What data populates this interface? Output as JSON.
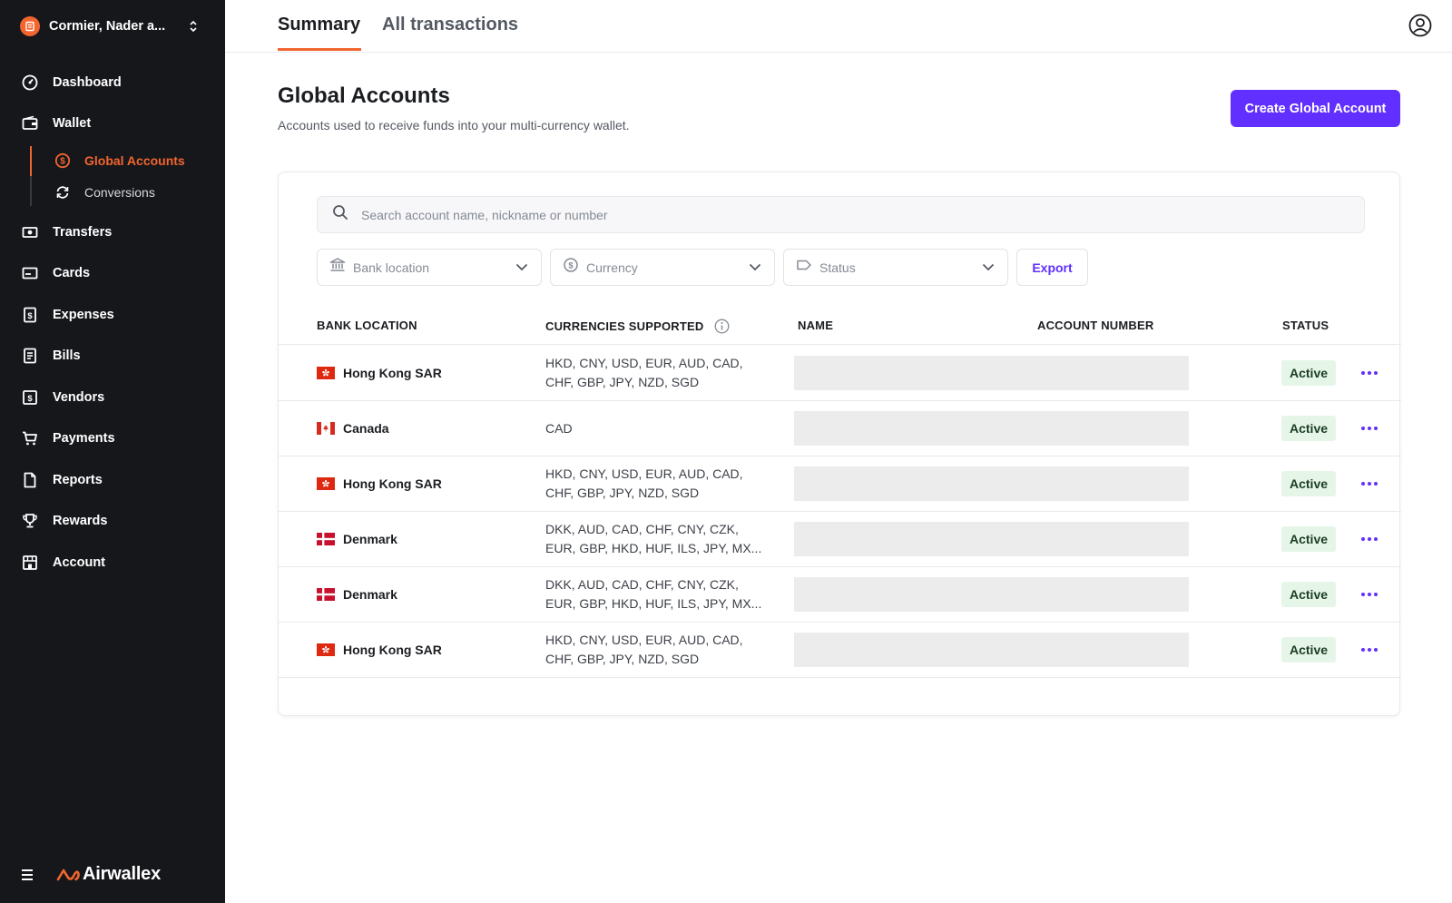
{
  "org": {
    "name": "Cormier, Nader a...",
    "icon": "building-icon"
  },
  "nav": {
    "dashboard": "Dashboard",
    "wallet": "Wallet",
    "global_accounts": "Global Accounts",
    "conversions": "Conversions",
    "transfers": "Transfers",
    "cards": "Cards",
    "expenses": "Expenses",
    "bills": "Bills",
    "vendors": "Vendors",
    "payments": "Payments",
    "reports": "Reports",
    "rewards": "Rewards",
    "account": "Account"
  },
  "brand": {
    "name": "Airwallex",
    "accent": "#f2652f",
    "primary": "#612fff"
  },
  "tabs": {
    "summary": "Summary",
    "all_transactions": "All transactions"
  },
  "header": {
    "title": "Global Accounts",
    "subtitle": "Accounts used to receive funds into your multi-currency wallet.",
    "create_button": "Create Global Account"
  },
  "search": {
    "placeholder": "Search account name, nickname or number"
  },
  "filters": {
    "bank_location": "Bank location",
    "currency": "Currency",
    "status": "Status",
    "export": "Export"
  },
  "table": {
    "headers": {
      "bank_location": "BANK LOCATION",
      "currencies": "CURRENCIES SUPPORTED",
      "name": "NAME",
      "account_number": "ACCOUNT NUMBER",
      "status": "STATUS"
    },
    "rows": [
      {
        "location": "Hong Kong SAR",
        "flag": "hk",
        "currencies": "HKD, CNY, USD, EUR, AUD, CAD, CHF, GBP, JPY, NZD, SGD",
        "status": "Active"
      },
      {
        "location": "Canada",
        "flag": "ca",
        "currencies": "CAD",
        "status": "Active"
      },
      {
        "location": "Hong Kong SAR",
        "flag": "hk",
        "currencies": "HKD, CNY, USD, EUR, AUD, CAD, CHF, GBP, JPY, NZD, SGD",
        "status": "Active"
      },
      {
        "location": "Denmark",
        "flag": "dk",
        "currencies": "DKK, AUD, CAD, CHF, CNY, CZK, EUR, GBP, HKD, HUF, ILS, JPY, MX...",
        "status": "Active"
      },
      {
        "location": "Denmark",
        "flag": "dk",
        "currencies": "DKK, AUD, CAD, CHF, CNY, CZK, EUR, GBP, HKD, HUF, ILS, JPY, MX...",
        "status": "Active"
      },
      {
        "location": "Hong Kong SAR",
        "flag": "hk",
        "currencies": "HKD, CNY, USD, EUR, AUD, CAD, CHF, GBP, JPY, NZD, SGD",
        "status": "Active"
      }
    ]
  }
}
